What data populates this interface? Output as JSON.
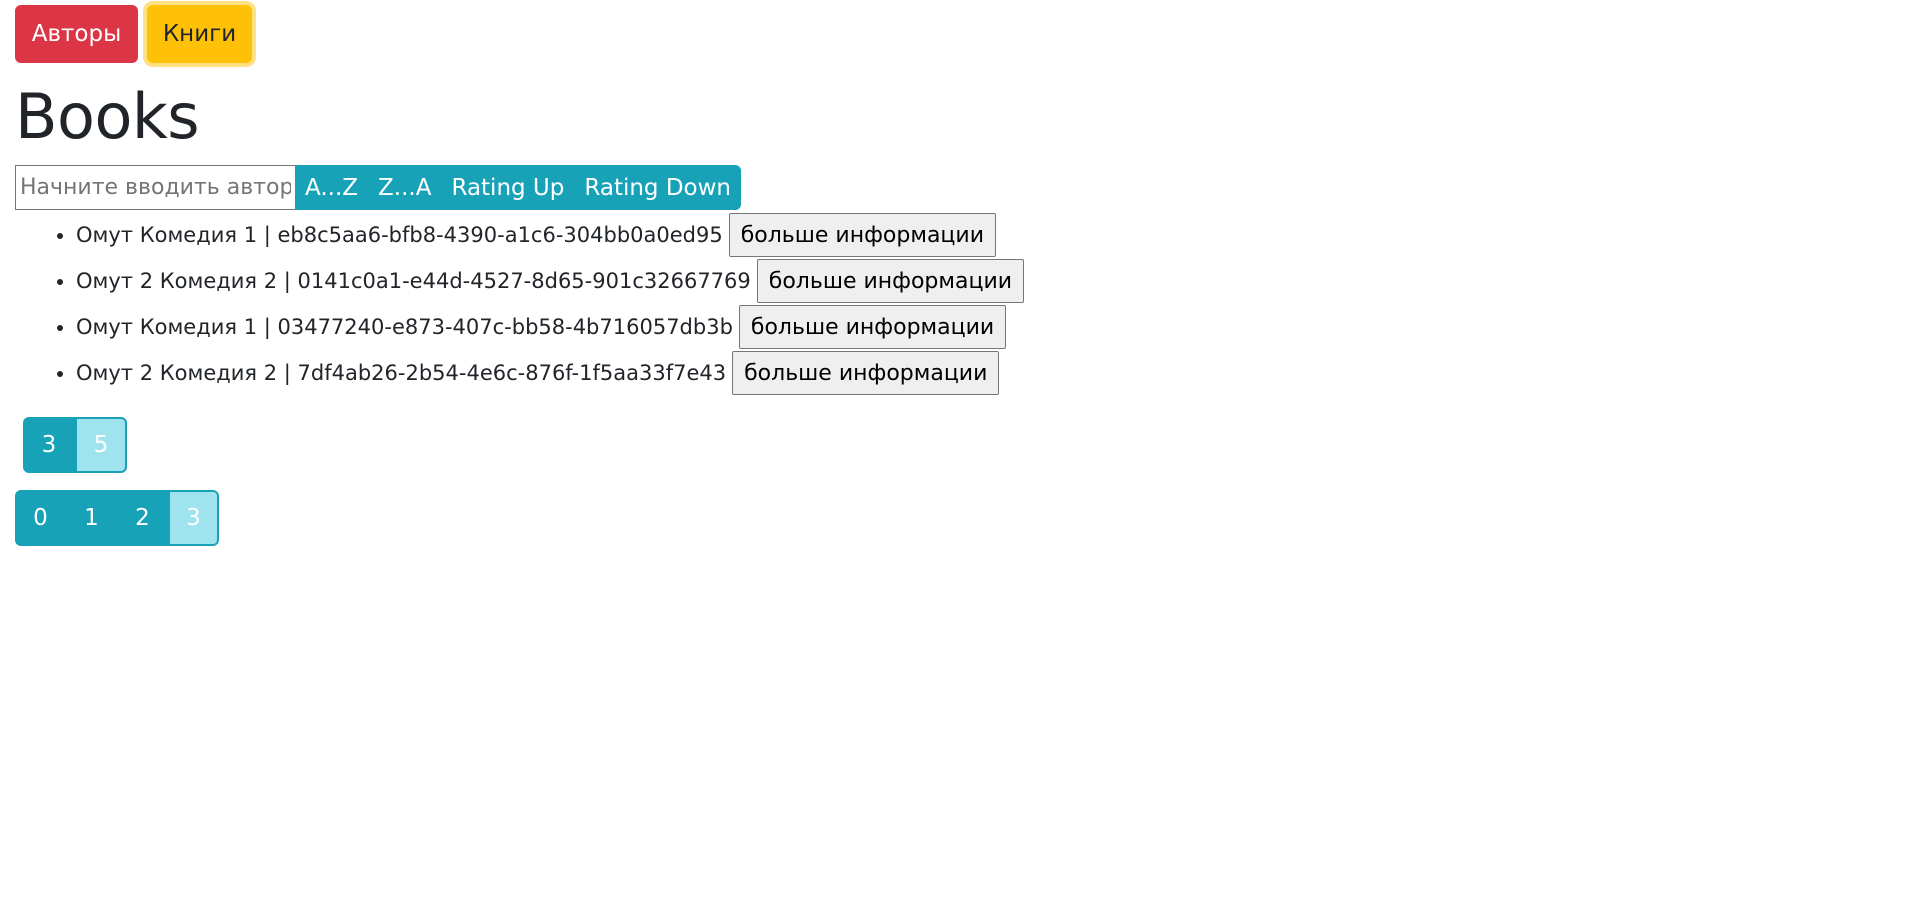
{
  "nav": {
    "authors_label": "Авторы",
    "books_label": "Книги"
  },
  "page": {
    "title": "Books"
  },
  "search": {
    "placeholder": "Начните вводить автора",
    "value": ""
  },
  "sort": {
    "az_label": "A...Z",
    "za_label": "Z...A",
    "rating_up_label": "Rating Up",
    "rating_down_label": "Rating Down"
  },
  "books": [
    {
      "text": "Омут Комедия 1 | eb8c5aa6-bfb8-4390-a1c6-304bb0a0ed95",
      "button_label": "больше информации"
    },
    {
      "text": "Омут 2 Комедия 2 | 0141c0a1-e44d-4527-8d65-901c32667769",
      "button_label": "больше информации"
    },
    {
      "text": "Омут Комедия 1 | 03477240-e873-407c-bb58-4b716057db3b",
      "button_label": "больше информации"
    },
    {
      "text": "Омут 2 Комедия 2 | 7df4ab26-2b54-4e6c-876f-1f5aa33f7e43",
      "button_label": "больше информации"
    }
  ],
  "page_size": {
    "options": [
      "3",
      "5"
    ],
    "selected": "5"
  },
  "pagination": {
    "pages": [
      "0",
      "1",
      "2",
      "3"
    ],
    "current": "3"
  },
  "colors": {
    "danger": "#dc3545",
    "warning": "#ffc107",
    "info": "#17a2b8",
    "info_light": "#9fe3ef"
  }
}
